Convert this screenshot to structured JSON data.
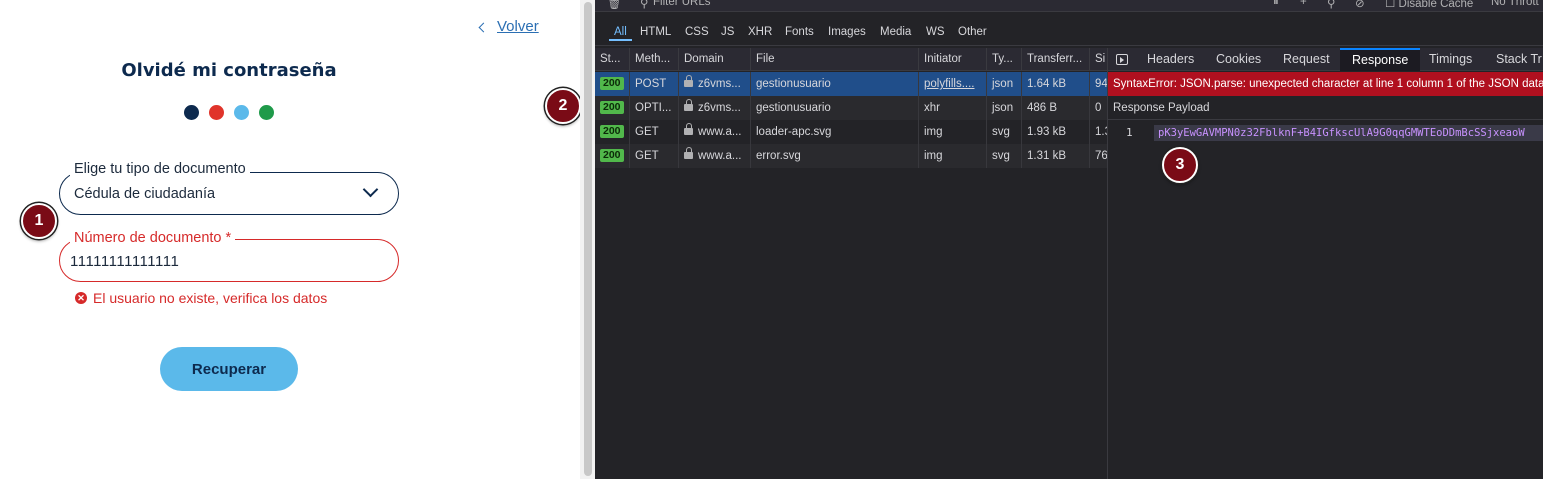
{
  "form": {
    "back_label": "Volver",
    "title": "Olvidé mi contraseña",
    "dots": [
      "#0d2a4e",
      "#e0342b",
      "#5bb9ea",
      "#1f9a4a"
    ],
    "doc_type": {
      "label": "Elige tu tipo de documento",
      "value": "Cédula de ciudadanía"
    },
    "doc_number": {
      "label": "Número de documento *",
      "value": "11111111111111"
    },
    "error_message": "El usuario no existe, verifica los datos",
    "submit_label": "Recuperar"
  },
  "annotations": [
    "1",
    "2",
    "3"
  ],
  "devtools": {
    "toolbar": {
      "filter_placeholder": "Filter URLs",
      "disable_cache": "Disable Cache",
      "throttle": "No Thrott"
    },
    "filters": [
      "All",
      "HTML",
      "CSS",
      "JS",
      "XHR",
      "Fonts",
      "Images",
      "Media",
      "WS",
      "Other"
    ],
    "columns": [
      "St...",
      "Meth...",
      "Domain",
      "File",
      "Initiator",
      "Ty...",
      "Transferr...",
      "Si"
    ],
    "rows": [
      {
        "status": "200",
        "method": "POST",
        "domain": "z6vms...",
        "file": "gestionusuario",
        "initiator": "polyfills....",
        "type": "json",
        "transferred": "1.64 kB",
        "size": "94"
      },
      {
        "status": "200",
        "method": "OPTI...",
        "domain": "z6vms...",
        "file": "gestionusuario",
        "initiator": "xhr",
        "type": "json",
        "transferred": "486 B",
        "size": "0"
      },
      {
        "status": "200",
        "method": "GET",
        "domain": "www.a...",
        "file": "loader-apc.svg",
        "initiator": "img",
        "type": "svg",
        "transferred": "1.93 kB",
        "size": "1.3"
      },
      {
        "status": "200",
        "method": "GET",
        "domain": "www.a...",
        "file": "error.svg",
        "initiator": "img",
        "type": "svg",
        "transferred": "1.31 kB",
        "size": "76"
      }
    ],
    "detail_tabs": [
      "Headers",
      "Cookies",
      "Request",
      "Response",
      "Timings",
      "Stack Tr"
    ],
    "active_tab": "Response",
    "error_text": "SyntaxError: JSON.parse: unexpected character at line 1 column 1 of the JSON data",
    "payload_header": "Response Payload",
    "payload_line": "1",
    "payload_text": "pK3yEwGAVMPN0z32FblknF+B4IGfkscUlA9G0qqGMWTEoDDmBcSSjxeaoW"
  }
}
